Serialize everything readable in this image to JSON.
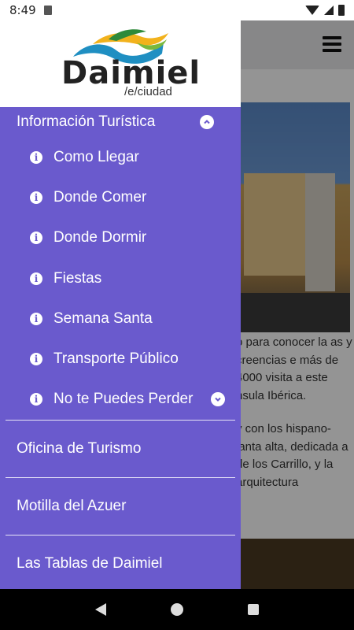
{
  "status_bar": {
    "time": "8:49"
  },
  "drawer": {
    "logo_text": "Daimiel",
    "logo_sub": "/e/ciudad",
    "section": {
      "label": "Información Turística",
      "items": [
        {
          "label": "Como Llegar"
        },
        {
          "label": "Donde Comer"
        },
        {
          "label": "Donde Dormir"
        },
        {
          "label": "Fiestas"
        },
        {
          "label": "Semana Santa"
        },
        {
          "label": "Transporte Público"
        },
        {
          "label": "No te Puedes Perder"
        }
      ]
    },
    "menu": [
      {
        "label": "Oficina de Turismo"
      },
      {
        "label": "Motilla del Azuer"
      },
      {
        "label": "Las Tablas de Daimiel"
      }
    ]
  },
  "background_page": {
    "paragraph_1": "o para conocer la as y creencias e más de 4000 visita a este nsula Ibérica.",
    "paragraph_2": "y con los hispano- lanta alta, dedicada a de los Carrillo, y la arquitectura"
  },
  "colors": {
    "drawer_bg": "#6a5acd",
    "header_bg": "#ffffff",
    "nav_bg": "#000000"
  }
}
